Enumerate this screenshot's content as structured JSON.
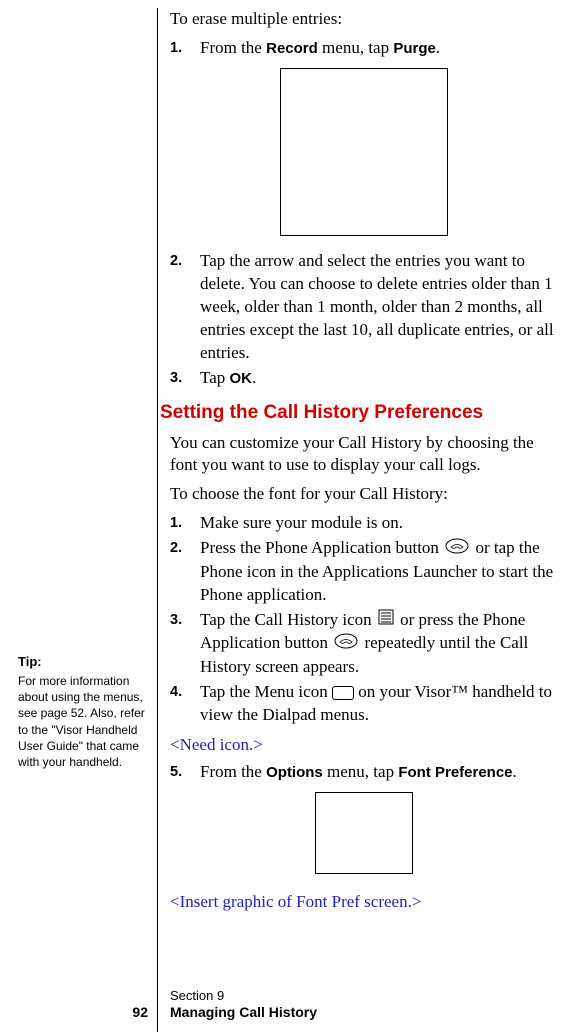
{
  "intro1": "To erase multiple entries:",
  "steps1": {
    "s1_num": "1.",
    "s1_pre": "From the ",
    "s1_menu": "Record",
    "s1_mid": " menu, tap ",
    "s1_action": "Purge",
    "s1_post": ".",
    "s2_num": "2.",
    "s2_body": "Tap the arrow and select the entries you want to delete. You can choose to delete entries older than 1 week, older than 1 month, older than 2 months, all entries except the last 10, all duplicate entries, or all entries.",
    "s3_num": "3.",
    "s3_pre": "Tap ",
    "s3_action": "OK",
    "s3_post": "."
  },
  "heading2": "Setting the Call History Preferences",
  "para2a": "You can customize your Call History by choosing the font you want to use to display your call logs.",
  "para2b": "To choose the font for your Call History:",
  "steps2": {
    "s1_num": "1.",
    "s1_body": "Make sure your module is on.",
    "s2_num": "2.",
    "s2_pre": "Press the Phone Application button ",
    "s2_post": " or tap the Phone icon in the Applications Launcher to start the Phone application.",
    "s3_num": "3.",
    "s3_pre": "Tap the Call History icon ",
    "s3_mid": " or press the Phone Application button ",
    "s3_post": " repeatedly until the Call History screen appears.",
    "s4_num": "4.",
    "s4_pre": "Tap the Menu icon ",
    "s4_post": " on your Visor™ handheld to view the Dialpad menus.",
    "s5_num": "5.",
    "s5_pre": "From the ",
    "s5_menu": "Options",
    "s5_mid": " menu, tap ",
    "s5_action": "Font Preference",
    "s5_post": "."
  },
  "editorial1": "<Need icon.>",
  "editorial2": "<Insert graphic of Font Pref screen.>",
  "tip": {
    "heading": "Tip:",
    "body": "For more information about using the menus, see page 52. Also, refer to the \"Visor Handheld User Guide\" that came with your handheld."
  },
  "footer": {
    "page": "92",
    "section": "Section 9",
    "title": "Managing Call History"
  }
}
